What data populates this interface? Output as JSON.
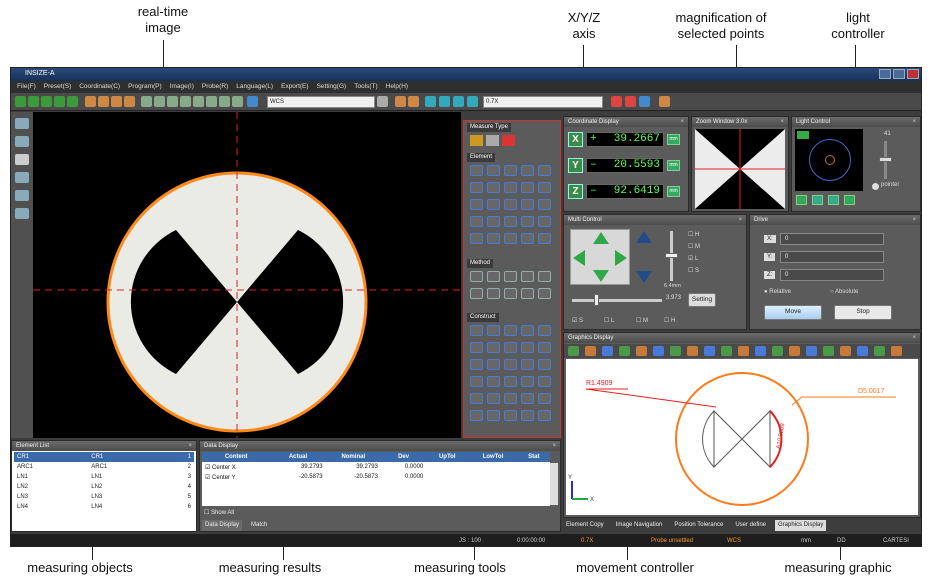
{
  "callouts": {
    "realtime": "real-time\nimage",
    "xyz_axis": "X/Y/Z\naxis",
    "magnification": "magnification of\nselected points",
    "light": "light\ncontroller",
    "objects": "measuring objects",
    "results": "measuring results",
    "tools": "measuring tools",
    "movement": "movement controller",
    "graphic": "measuring graphic"
  },
  "window": {
    "title": "INSIZE-A"
  },
  "menu": [
    "File(F)",
    "Preset(S)",
    "Coordinate(C)",
    "Program(P)",
    "Image(I)",
    "Probe(R)",
    "Language(L)",
    "Export(E)",
    "Setting(G)",
    "Tools(T)",
    "Help(H)"
  ],
  "toolbar": {
    "wcs": "WCS",
    "zoom": "0.7X"
  },
  "measure_tools": {
    "title": "Measure Type",
    "element": "Element",
    "method": "Method",
    "construct": "Construct"
  },
  "coordinate": {
    "title": "Coordinate Display",
    "rows": [
      {
        "axis": "X",
        "sign": "+",
        "value": "39.2667",
        "unit": "mm"
      },
      {
        "axis": "Y",
        "sign": "–",
        "value": "20.5593",
        "unit": "mm"
      },
      {
        "axis": "Z",
        "sign": "–",
        "value": "92.6419",
        "unit": "mm"
      }
    ]
  },
  "zoom_panel": {
    "title": "Zoom Window 3.0x"
  },
  "light_panel": {
    "title": "Light Control",
    "level": "41",
    "pointer": "pointer"
  },
  "motion": {
    "title": "Multi Control",
    "checks": [
      "H",
      "M",
      "L",
      "S"
    ],
    "speed_label": "6.4mm",
    "speed_value": "3.973",
    "setting": "Setting",
    "bottom_checks": [
      "S",
      "L",
      "M",
      "H"
    ]
  },
  "drive": {
    "title": "Drive",
    "axes": [
      {
        "label": "X:",
        "value": "0"
      },
      {
        "label": "Y:",
        "value": "0"
      },
      {
        "label": "Z:",
        "value": "0"
      }
    ],
    "relative": "Relative",
    "absolute": "Absolute",
    "move": "Move",
    "stop": "Stop"
  },
  "graphics": {
    "title": "Graphics Display",
    "r_label": "R1.4909",
    "d_label": "D5.0017",
    "arc_label": "A10.9809",
    "axis_y": "Y",
    "axis_x": "X"
  },
  "element_list": {
    "title": "Element List",
    "rows": [
      {
        "name": "CR1",
        "alias": "CR1",
        "idx": "1"
      },
      {
        "name": "ARC1",
        "alias": "ARC1",
        "idx": "2"
      },
      {
        "name": "LN1",
        "alias": "LN1",
        "idx": "3"
      },
      {
        "name": "LN2",
        "alias": "LN2",
        "idx": "4"
      },
      {
        "name": "LN3",
        "alias": "LN3",
        "idx": "5"
      },
      {
        "name": "LN4",
        "alias": "LN4",
        "idx": "6"
      }
    ]
  },
  "data_display": {
    "title": "Data Display",
    "headers": [
      "Content",
      "Actual",
      "Nominal",
      "Dev",
      "UpTol",
      "LowTol",
      "Stat"
    ],
    "rows": [
      {
        "name": "Center X",
        "actual": "39.2793",
        "nominal": "39.2793",
        "dev": "0.0000"
      },
      {
        "name": "Center Y",
        "actual": "-20.5873",
        "nominal": "-20.5873",
        "dev": "0.0000"
      }
    ],
    "show_all": "Show All",
    "tabs": [
      "Data Display",
      "Match"
    ]
  },
  "right_tabs": [
    "Element Copy",
    "Image Navigation",
    "Position Tolerance",
    "User define",
    "Graphics Display"
  ],
  "status": {
    "js": "JS : 100",
    "time": "0:00:00:00",
    "zoom": "0.7X",
    "probe": "Probe unsettled",
    "wcs": "WCS",
    "unit": "mm",
    "dd": "DD",
    "cartesian": "CARTESI"
  },
  "colors": {
    "accent_green": "#5cff5c",
    "graphic_orange": "#ff7a1a",
    "graphic_red": "#e02020",
    "panel_red": "#d02020"
  }
}
